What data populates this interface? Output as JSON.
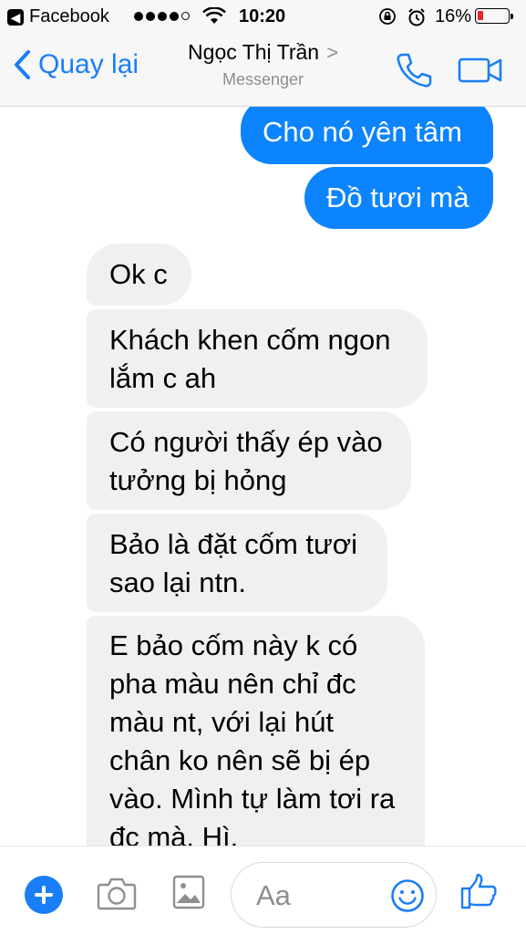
{
  "status_bar": {
    "back_app": "Facebook",
    "time": "10:20",
    "battery_percent": "16%",
    "battery_level": 0.16,
    "signal_bars": 4,
    "signal_max": 5
  },
  "nav": {
    "back_label": "Quay lại",
    "contact_name": "Ngọc Thị Trần",
    "subtitle": "Messenger"
  },
  "messages": [
    {
      "direction": "outgoing",
      "lines": [
        "Cho nó yên tâm"
      ]
    },
    {
      "direction": "outgoing",
      "lines": [
        "Đồ tươi mà"
      ]
    },
    {
      "direction": "incoming",
      "lines": [
        "Ok c"
      ]
    },
    {
      "direction": "incoming",
      "lines": [
        "Khách khen cốm ngon",
        "lắm c ah"
      ]
    },
    {
      "direction": "incoming",
      "lines": [
        "Có người thấy ép vào",
        "tưởng bị hỏng"
      ]
    },
    {
      "direction": "incoming",
      "lines": [
        "Bảo là đặt cốm tươi",
        "sao lại ntn."
      ]
    },
    {
      "direction": "incoming",
      "lines": [
        "E bảo cốm này k có",
        "pha màu nên chỉ đc",
        "màu nt, với lại hút",
        "chân ko nên sẽ bị ép",
        "vào. Mình tự làm tơi ra",
        "đc mà. Hì."
      ]
    }
  ],
  "composer": {
    "placeholder": "Aa"
  },
  "colors": {
    "accent": "#1a7ef7",
    "outgoing_bubble": "#0c84fe",
    "incoming_bubble": "#f0f0f0"
  }
}
